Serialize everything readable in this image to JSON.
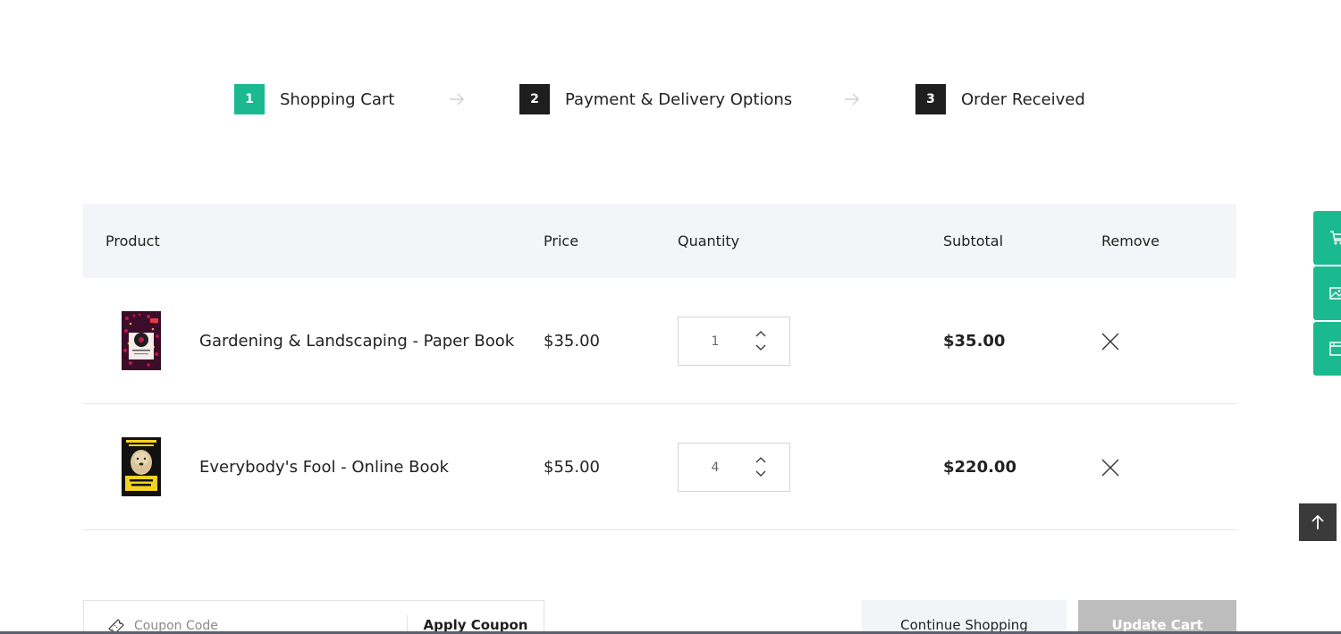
{
  "steps": [
    {
      "number": "1",
      "label": "Shopping Cart",
      "state": "active"
    },
    {
      "number": "2",
      "label": "Payment & Delivery Options",
      "state": "pending"
    },
    {
      "number": "3",
      "label": "Order Received",
      "state": "pending"
    }
  ],
  "table": {
    "headers": {
      "product": "Product",
      "price": "Price",
      "quantity": "Quantity",
      "subtotal": "Subtotal",
      "remove": "Remove"
    },
    "rows": [
      {
        "product": "Gardening & Landscaping - Paper Book",
        "price": "$35.00",
        "quantity": "1",
        "subtotal": "$35.00"
      },
      {
        "product": "Everybody's Fool - Online Book",
        "price": "$55.00",
        "quantity": "4",
        "subtotal": "$220.00"
      }
    ]
  },
  "coupon": {
    "placeholder": "Coupon Code",
    "apply_label": "Apply Coupon"
  },
  "actions": {
    "continue_label": "Continue Shopping",
    "update_label": "Update Cart"
  },
  "icons": {
    "step_arrow": "arrow-right-icon",
    "spin_up": "chevron-up-icon",
    "spin_down": "chevron-down-icon",
    "remove": "close-icon",
    "coupon": "ticket-icon",
    "float": [
      "cart-icon",
      "image-icon",
      "browser-window-icon"
    ],
    "to_top": "arrow-up-icon"
  },
  "colors": {
    "accent": "#1bb98f",
    "dark": "#1e1e1e",
    "header_bg": "#f4f5f8",
    "update_btn": "#bdbdbd"
  }
}
